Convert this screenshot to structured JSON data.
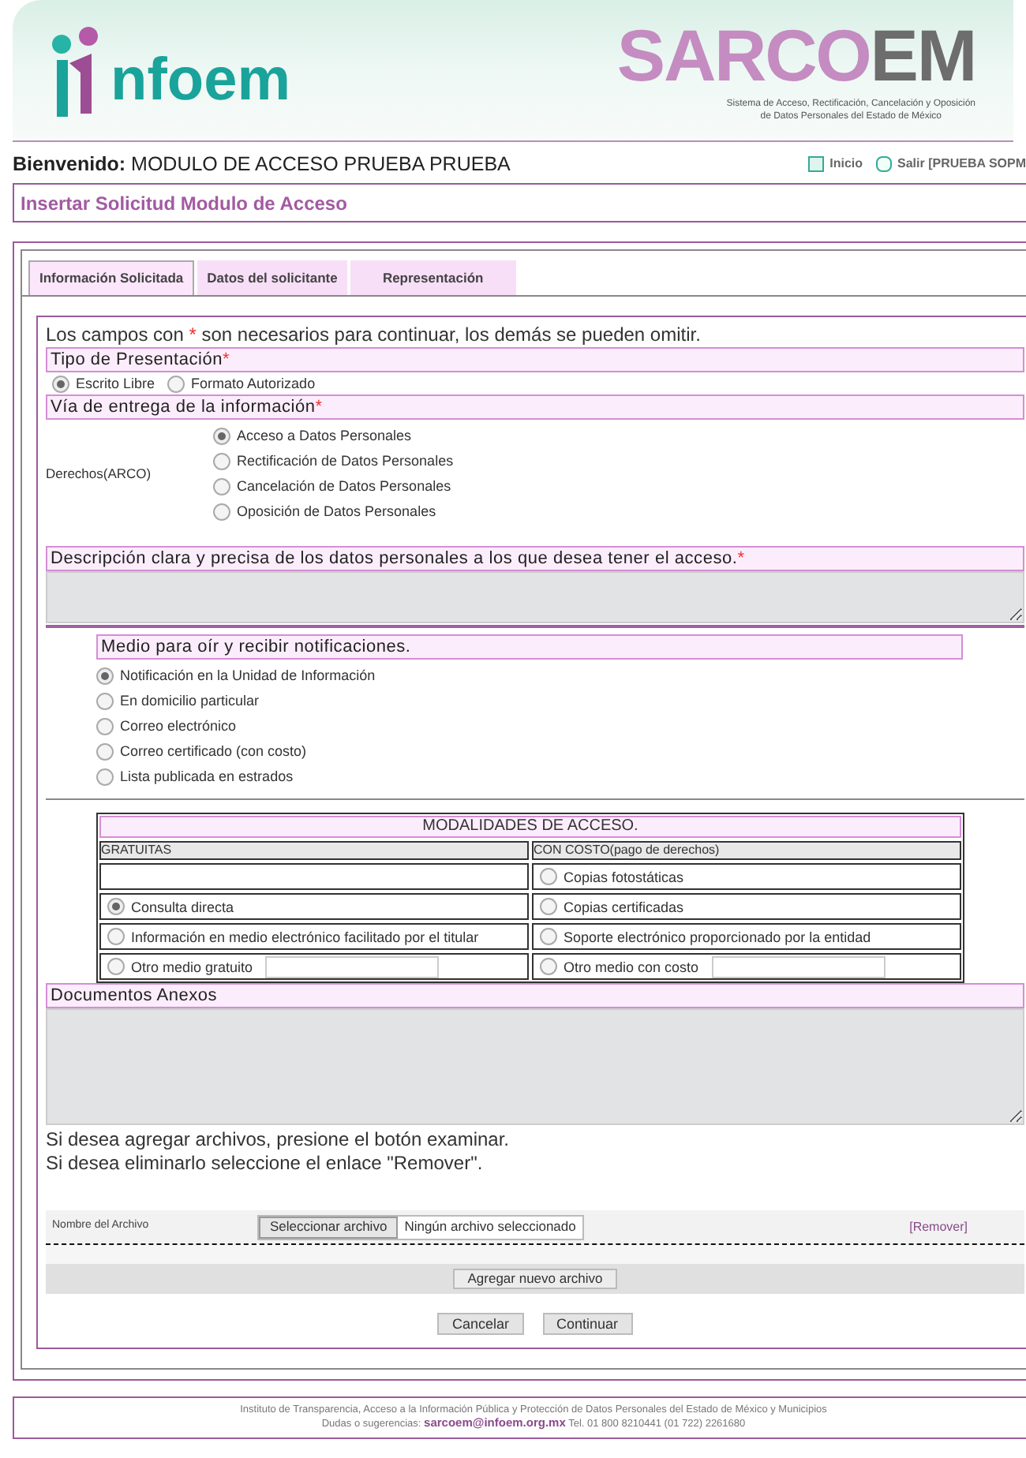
{
  "header": {
    "logo_text": "nfoem",
    "brand_primary": "SARCO",
    "brand_secondary": "EM",
    "subtitle_lines": [
      "Sistema de Acceso, Rectificación, Cancelación y Oposición",
      "de Datos Personales del Estado de México"
    ]
  },
  "welcome": {
    "label": "Bienvenido:",
    "name": "MODULO DE ACCESO PRUEBA PRUEBA"
  },
  "nav_links": [
    {
      "kind": "home",
      "label": "Inicio"
    },
    {
      "kind": "exit",
      "label": "Salir [PRUEBA SOPM"
    }
  ],
  "page_title": "Insertar Solicitud Modulo de Acceso",
  "tabs": [
    {
      "label": "Información Solicitada",
      "selected": true
    },
    {
      "label": "Datos del solicitante",
      "selected": false
    },
    {
      "label": "Representación",
      "selected": false
    }
  ],
  "form": {
    "notice_before": "Los campos con",
    "required_mark": "*",
    "notice_after": "son necesarios para continuar, los demás se pueden omitir.",
    "presentation": {
      "heading": "Tipo de Presentación",
      "required": true,
      "options": [
        {
          "label": "Escrito Libre",
          "selected": true
        },
        {
          "label": "Formato Autorizado",
          "selected": false
        }
      ]
    },
    "delivery": {
      "heading": "Vía de entrega de la información",
      "required": true,
      "rights_label": "Derechos(ARCO)",
      "options": [
        {
          "label": "Acceso a Datos Personales",
          "selected": true
        },
        {
          "label": "Rectificación de Datos Personales",
          "selected": false
        },
        {
          "label": "Cancelación de Datos Personales",
          "selected": false
        },
        {
          "label": "Oposición de Datos Personales",
          "selected": false
        }
      ]
    },
    "description": {
      "heading": "Descripción clara y precisa de los datos personales a los que desea tener el acceso.",
      "required": true
    },
    "notifications": {
      "heading": "Medio para oír y recibir notificaciones.",
      "required": false,
      "options": [
        {
          "label": "Notificación en la Unidad de Información",
          "selected": true
        },
        {
          "label": "En domicilio particular",
          "selected": false
        },
        {
          "label": "Correo electrónico",
          "selected": false
        },
        {
          "label": "Correo certificado (con costo)",
          "selected": false
        },
        {
          "label": "Lista publicada en estrados",
          "selected": false
        }
      ]
    },
    "modalities": {
      "title": "MODALIDADES DE ACCESO.",
      "columns": [
        "GRATUITAS",
        "CON COSTO(pago de derechos)"
      ],
      "rows": [
        [
          {
            "kind": "empty"
          },
          {
            "kind": "radio",
            "label": "Copias fotostáticas",
            "selected": false
          }
        ],
        [
          {
            "kind": "radio",
            "label": "Consulta directa",
            "selected": true
          },
          {
            "kind": "radio",
            "label": "Copias certificadas",
            "selected": false
          }
        ],
        [
          {
            "kind": "radio",
            "label": "Información en medio electrónico facilitado por el titular",
            "selected": false
          },
          {
            "kind": "radio",
            "label": "Soporte electrónico proporcionado por la entidad",
            "selected": false
          }
        ],
        [
          {
            "kind": "radio_input",
            "label": "Otro medio gratuito",
            "selected": false
          },
          {
            "kind": "radio_input",
            "label": "Otro medio con costo",
            "selected": false
          }
        ]
      ]
    },
    "attachments": {
      "heading": "Documentos Anexos",
      "required": false
    },
    "instructions": [
      "Si desea agregar archivos, presione el botón examinar.",
      "Si desea eliminarlo seleccione el enlace \"Remover\"."
    ],
    "file_row": {
      "label": "Nombre del Archivo",
      "button": "Seleccionar archivo",
      "status": "Ningún archivo seleccionado",
      "remove_link": "[Remover]"
    },
    "add_file_button": "Agregar nuevo archivo",
    "buttons": [
      "Cancelar",
      "Continuar"
    ]
  },
  "footer": {
    "line1": "Instituto de Transparencia, Acceso a la Información Pública y Protección de Datos Personales del Estado de México y Municipios",
    "contact_label": "Dudas o sugerencias:",
    "email": "sarcoem@infoem.org.mx",
    "phone": "Tel. 01 800 8210441 (01 722) 2261680"
  }
}
